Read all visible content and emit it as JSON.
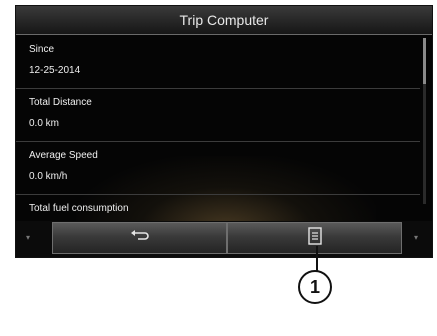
{
  "header": {
    "title": "Trip Computer"
  },
  "items": [
    {
      "label": "Since",
      "value": "12-25-2014"
    },
    {
      "label": "Total Distance",
      "value": "0.0 km"
    },
    {
      "label": "Average Speed",
      "value": "0.0 km/h"
    },
    {
      "label": "Total fuel consumption",
      "value": ""
    }
  ],
  "bottombar": {
    "back_icon": "back-arrow-icon",
    "menu_icon": "list-menu-icon"
  },
  "callout": {
    "label": "1"
  }
}
